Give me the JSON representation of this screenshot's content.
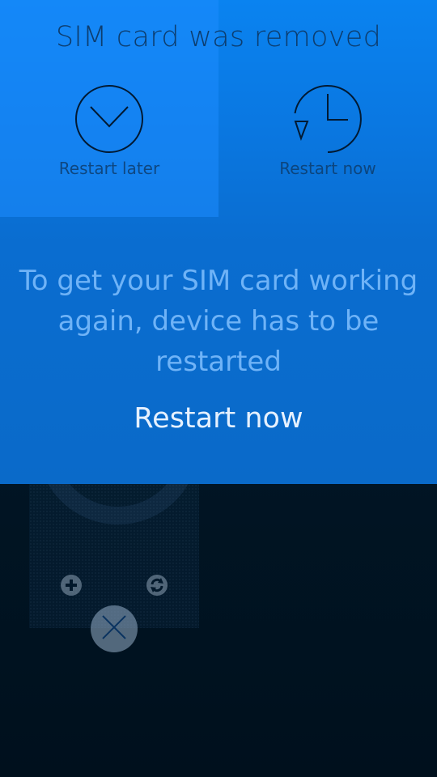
{
  "dialog": {
    "title": "SIM card was removed",
    "options": [
      {
        "label": "Restart later",
        "icon": "envelope-icon"
      },
      {
        "label": "Restart now",
        "icon": "clock-icon"
      }
    ],
    "message": "To get your SIM card working again, device has to be restarted",
    "primary_action": "Restart now"
  },
  "background": {
    "cover_actions": [
      {
        "icon": "add-icon"
      },
      {
        "icon": "refresh-icon"
      }
    ],
    "close_icon": "close-icon"
  },
  "colors": {
    "dialog_top": "#0a83f0",
    "dialog_bottom": "#0a6ac9",
    "title_text": "#0d3d6e",
    "message_text": "#6fb3f7",
    "action_text": "#e6f1ff",
    "background": "#000f1c"
  }
}
